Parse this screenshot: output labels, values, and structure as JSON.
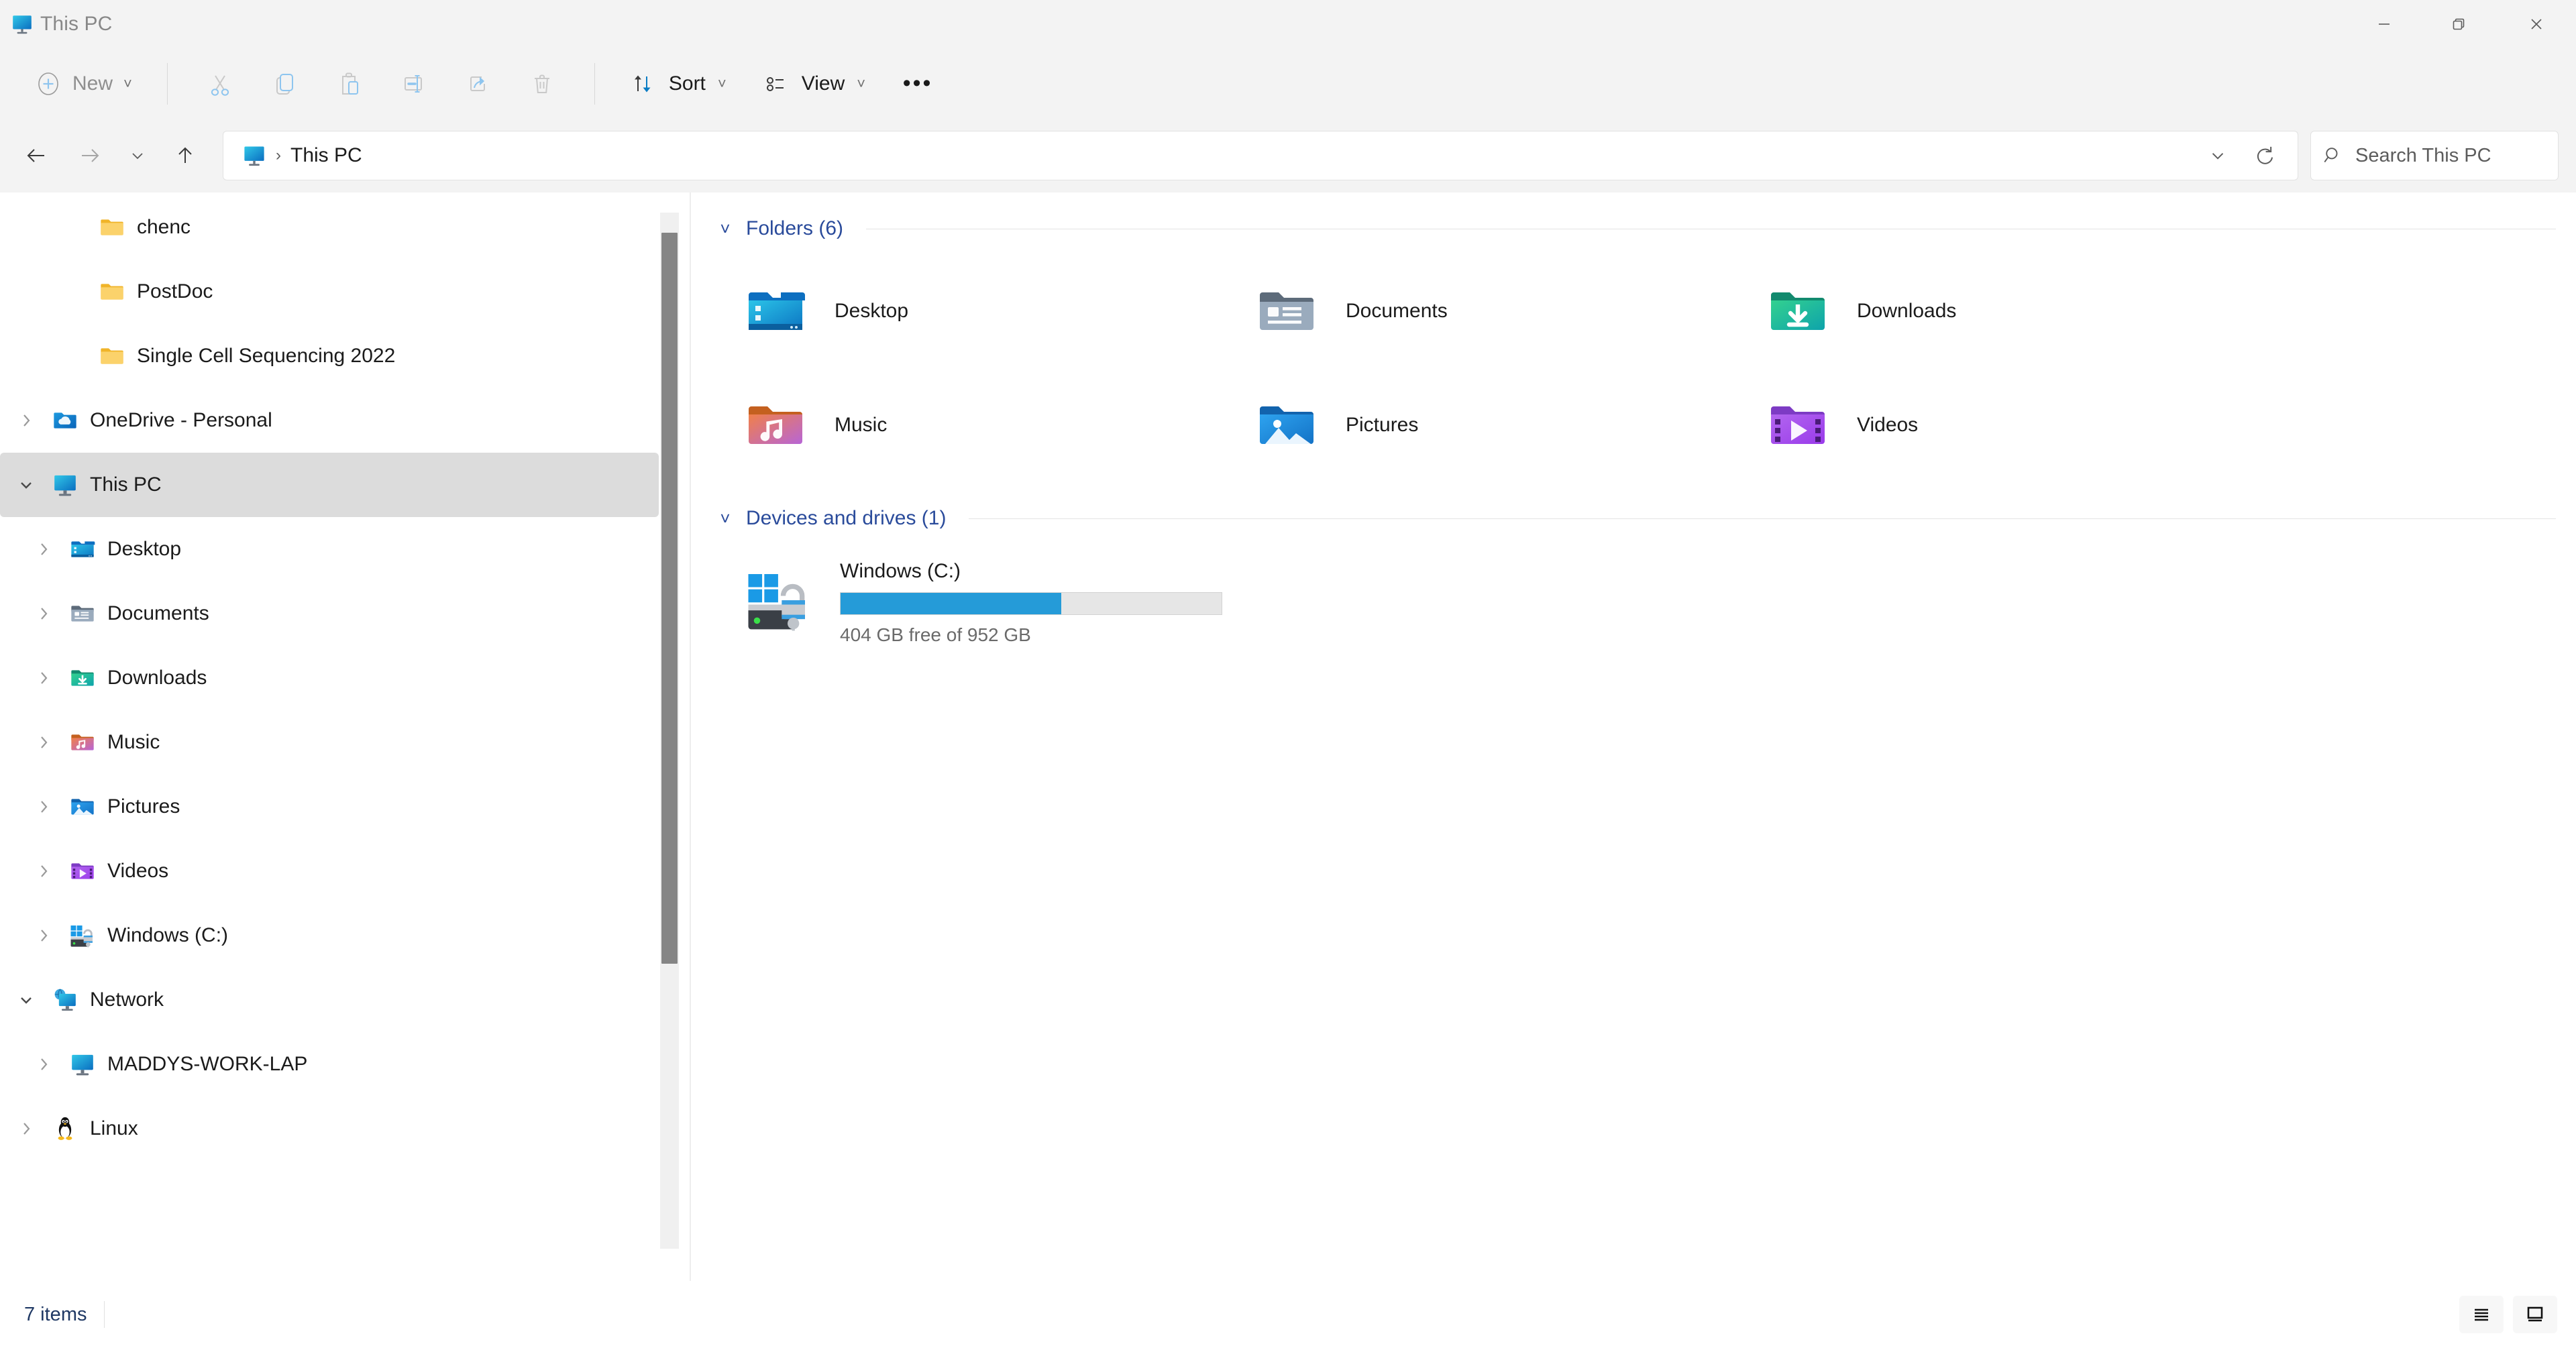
{
  "window": {
    "title": "This PC",
    "title_icon": "this-pc-monitor-icon",
    "controls": {
      "minimize": "Minimize",
      "restore": "Restore",
      "close": "Close"
    }
  },
  "toolbar": {
    "new_label": "New",
    "new_icon": "plus-circle-icon",
    "actions": [
      {
        "name": "cut",
        "icon": "scissors-icon",
        "enabled": false
      },
      {
        "name": "copy",
        "icon": "copy-icon",
        "enabled": false
      },
      {
        "name": "paste",
        "icon": "clipboard-paste-icon",
        "enabled": false
      },
      {
        "name": "rename",
        "icon": "rename-icon",
        "enabled": false
      },
      {
        "name": "share",
        "icon": "share-icon",
        "enabled": false
      },
      {
        "name": "delete",
        "icon": "trash-icon",
        "enabled": false
      }
    ],
    "sort_label": "Sort",
    "sort_icon": "sort-arrows-icon",
    "view_label": "View",
    "view_icon": "view-list-icon",
    "more_label": "•••"
  },
  "address": {
    "back_icon": "arrow-left-icon",
    "forward_icon": "arrow-right-icon",
    "history_icon": "chevron-down-icon",
    "up_icon": "arrow-up-icon",
    "breadcrumb_icon": "this-pc-monitor-icon",
    "breadcrumb_separator": "›",
    "breadcrumb_text": "This PC",
    "dropdown_icon": "chevron-down-icon",
    "refresh_icon": "refresh-icon",
    "search_icon": "search-icon",
    "search_placeholder": "Search This PC",
    "search_value": ""
  },
  "sidebar": {
    "items": [
      {
        "label": "chenc",
        "icon": "folder-yellow-icon",
        "indent": 2,
        "twisty": "",
        "selected": false
      },
      {
        "label": "PostDoc",
        "icon": "folder-yellow-icon",
        "indent": 2,
        "twisty": "",
        "selected": false
      },
      {
        "label": "Single Cell Sequencing 2022",
        "icon": "folder-yellow-icon",
        "indent": 2,
        "twisty": "",
        "selected": false
      },
      {
        "label": "OneDrive - Personal",
        "icon": "onedrive-icon",
        "indent": 0,
        "twisty": "collapsed",
        "selected": false
      },
      {
        "label": "This PC",
        "icon": "this-pc-monitor-icon",
        "indent": 0,
        "twisty": "expanded",
        "selected": true
      },
      {
        "label": "Desktop",
        "icon": "folder-desktop-icon",
        "indent": 1,
        "twisty": "collapsed",
        "selected": false
      },
      {
        "label": "Documents",
        "icon": "folder-documents-icon",
        "indent": 1,
        "twisty": "collapsed",
        "selected": false
      },
      {
        "label": "Downloads",
        "icon": "folder-downloads-icon",
        "indent": 1,
        "twisty": "collapsed",
        "selected": false
      },
      {
        "label": "Music",
        "icon": "folder-music-icon",
        "indent": 1,
        "twisty": "collapsed",
        "selected": false
      },
      {
        "label": "Pictures",
        "icon": "folder-pictures-icon",
        "indent": 1,
        "twisty": "collapsed",
        "selected": false
      },
      {
        "label": "Videos",
        "icon": "folder-videos-icon",
        "indent": 1,
        "twisty": "collapsed",
        "selected": false
      },
      {
        "label": "Windows (C:)",
        "icon": "drive-windows-icon",
        "indent": 1,
        "twisty": "collapsed",
        "selected": false
      },
      {
        "label": "Network",
        "icon": "network-icon",
        "indent": 0,
        "twisty": "expanded",
        "selected": false
      },
      {
        "label": "MADDYS-WORK-LAP",
        "icon": "computer-monitor-icon",
        "indent": 1,
        "twisty": "collapsed",
        "selected": false
      },
      {
        "label": "Linux",
        "icon": "linux-penguin-icon",
        "indent": 0,
        "twisty": "collapsed",
        "selected": false
      }
    ]
  },
  "content": {
    "folders_group": {
      "title": "Folders (6)",
      "items": [
        {
          "label": "Desktop",
          "icon": "folder-desktop-icon"
        },
        {
          "label": "Documents",
          "icon": "folder-documents-icon"
        },
        {
          "label": "Downloads",
          "icon": "folder-downloads-icon"
        },
        {
          "label": "Music",
          "icon": "folder-music-icon"
        },
        {
          "label": "Pictures",
          "icon": "folder-pictures-icon"
        },
        {
          "label": "Videos",
          "icon": "folder-videos-icon"
        }
      ]
    },
    "drives_group": {
      "title": "Devices and drives (1)",
      "items": [
        {
          "label": "Windows (C:)",
          "icon": "drive-windows-icon",
          "capacity_text": "404 GB free of 952 GB",
          "free_gb": 404,
          "total_gb": 952,
          "used_percent": 58,
          "bar_color": "#259bd8"
        }
      ]
    }
  },
  "statusbar": {
    "item_count": "7 items",
    "details_view_icon": "details-view-icon",
    "large_icons_view_icon": "large-icons-view-icon"
  }
}
